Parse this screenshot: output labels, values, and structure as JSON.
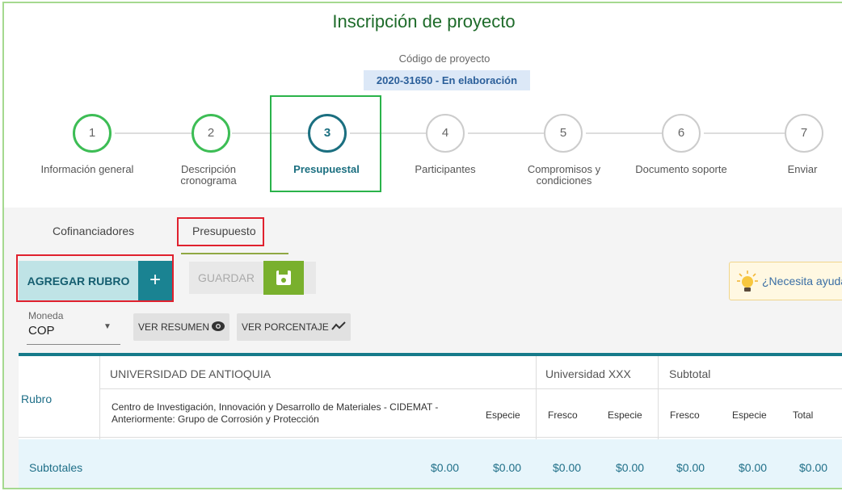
{
  "page": {
    "title": "Inscripción de proyecto",
    "code_label": "Código de proyecto",
    "code_value": "2020-31650 - En elaboración"
  },
  "steps": [
    {
      "num": "1",
      "label": "Información general",
      "state": "done"
    },
    {
      "num": "2",
      "label": "Descripción cronograma",
      "state": "done"
    },
    {
      "num": "3",
      "label": "Presupuestal",
      "state": "active"
    },
    {
      "num": "4",
      "label": "Participantes",
      "state": "pending"
    },
    {
      "num": "5",
      "label": "Compromisos y condiciones",
      "state": "pending"
    },
    {
      "num": "6",
      "label": "Documento soporte",
      "state": "pending"
    },
    {
      "num": "7",
      "label": "Enviar",
      "state": "pending"
    }
  ],
  "tabs": {
    "cofinanciadores": "Cofinanciadores",
    "presupuesto": "Presupuesto"
  },
  "toolbar": {
    "add_label": "AGREGAR RUBRO",
    "add_icon": "+",
    "save_label": "GUARDAR",
    "help_label": "¿Necesita ayuda"
  },
  "filters": {
    "moneda_label": "Moneda",
    "moneda_value": "COP",
    "ver_resumen": "VER RESUMEN",
    "ver_porcentaje": "VER PORCENTAJE"
  },
  "table": {
    "rubro_header": "Rubro",
    "group_udea": "UNIVERSIDAD DE ANTIOQUIA",
    "group_uxxx": "Universidad XXX",
    "group_subtotal": "Subtotal",
    "entity_name": "Centro de Investigación, Innovación y Desarrollo de Materiales - CIDEMAT - Anteriormente: Grupo de Corrosión y Protección",
    "col_especie_udea": "Especie",
    "col_fresco_uxxx": "Fresco",
    "col_especie_uxxx": "Especie",
    "col_fresco_sub": "Fresco",
    "col_especie_sub": "Especie",
    "col_total": "Total",
    "subtotales_label": "Subtotales",
    "subtotal_values": [
      "$0.00",
      "$0.00",
      "$0.00",
      "$0.00",
      "$0.00",
      "$0.00",
      "$0.00"
    ]
  },
  "colors": {
    "accent_teal": "#1a8392",
    "step_done": "#3dbd55",
    "highlight_red": "#e0212e",
    "save_green": "#79b02d"
  }
}
